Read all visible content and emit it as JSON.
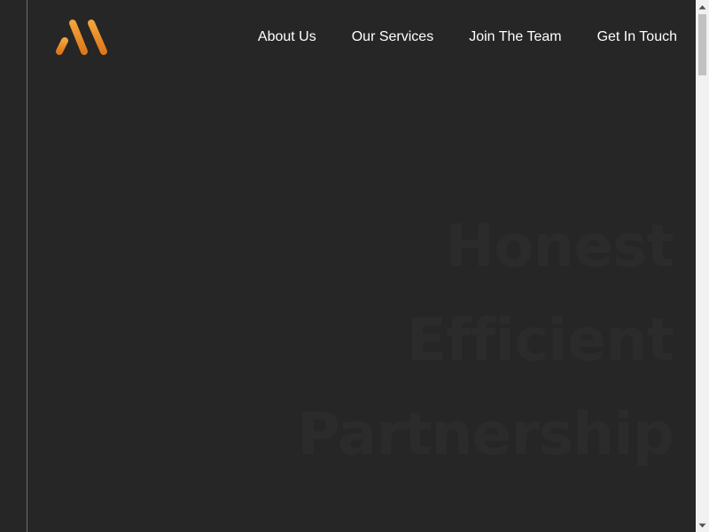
{
  "logo": {
    "icon": "brand-logo-icon",
    "gradient": [
      "#f2a33a",
      "#e0781a"
    ]
  },
  "nav": {
    "items": [
      {
        "label": "About Us"
      },
      {
        "label": "Our Services"
      },
      {
        "label": "Join The Team"
      },
      {
        "label": "Get In Touch"
      }
    ]
  },
  "hero": {
    "lines": [
      "Honest",
      "Efficient",
      "Partnership"
    ]
  },
  "colors": {
    "background": "#262626",
    "hero_text": "#2b2b2b",
    "nav_text": "#ffffff",
    "accent": "#e88a22"
  }
}
